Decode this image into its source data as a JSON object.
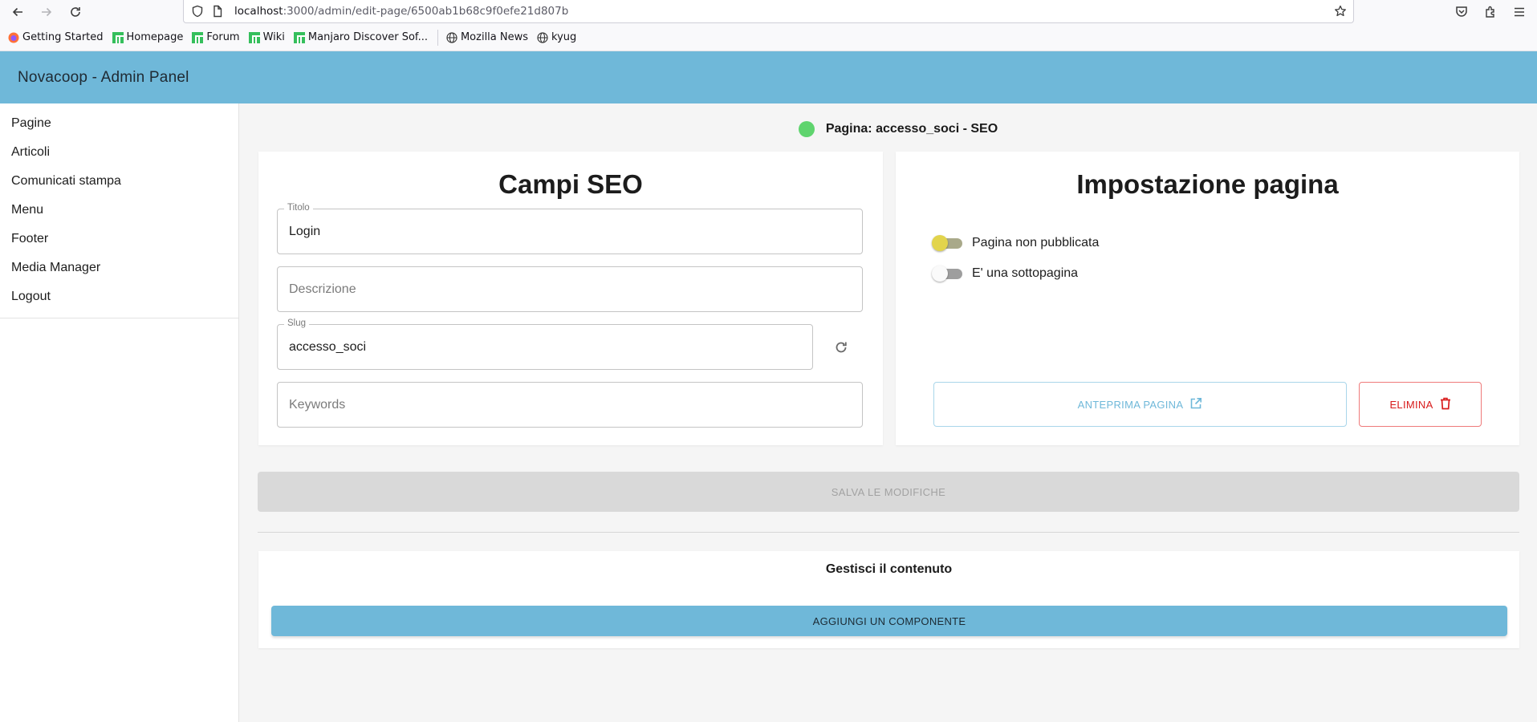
{
  "browser": {
    "url_host": "localhost",
    "url_path": ":3000/admin/edit-page/6500ab1b68c9f0efe21d807b",
    "bookmarks": [
      {
        "label": "Getting Started",
        "icon": "firefox-icon"
      },
      {
        "label": "Homepage",
        "icon": "manjaro-icon"
      },
      {
        "label": "Forum",
        "icon": "manjaro-icon"
      },
      {
        "label": "Wiki",
        "icon": "manjaro-icon"
      },
      {
        "label": "Manjaro Discover Sof...",
        "icon": "manjaro-icon"
      },
      {
        "label": "Mozilla News",
        "icon": "globe-icon"
      },
      {
        "label": "kyug",
        "icon": "globe-icon"
      }
    ]
  },
  "app": {
    "title": "Novacoop - Admin Panel",
    "accent": "#6fb8d9"
  },
  "sidebar": {
    "items": [
      {
        "label": "Pagine"
      },
      {
        "label": "Articoli"
      },
      {
        "label": "Comunicati stampa"
      },
      {
        "label": "Menu"
      },
      {
        "label": "Footer"
      },
      {
        "label": "Media Manager"
      },
      {
        "label": "Logout"
      }
    ]
  },
  "status": {
    "text": "Pagina: accesso_soci - SEO",
    "color": "#5fd46e"
  },
  "seo": {
    "title": "Campi SEO",
    "titolo_label": "Titolo",
    "titolo_value": "Login",
    "descrizione_placeholder": "Descrizione",
    "slug_label": "Slug",
    "slug_value": "accesso_soci",
    "keywords_placeholder": "Keywords"
  },
  "settings": {
    "title": "Impostazione pagina",
    "published_label": "Pagina non pubblicata",
    "subpage_label": "E' una sottopagina",
    "preview_label": "ANTEPRIMA PAGINA",
    "delete_label": "ELIMINA"
  },
  "save_label": "SALVA LE MODIFICHE",
  "content": {
    "title": "Gestisci il contenuto",
    "add_label": "AGGIUNGI UN COMPONENTE"
  }
}
